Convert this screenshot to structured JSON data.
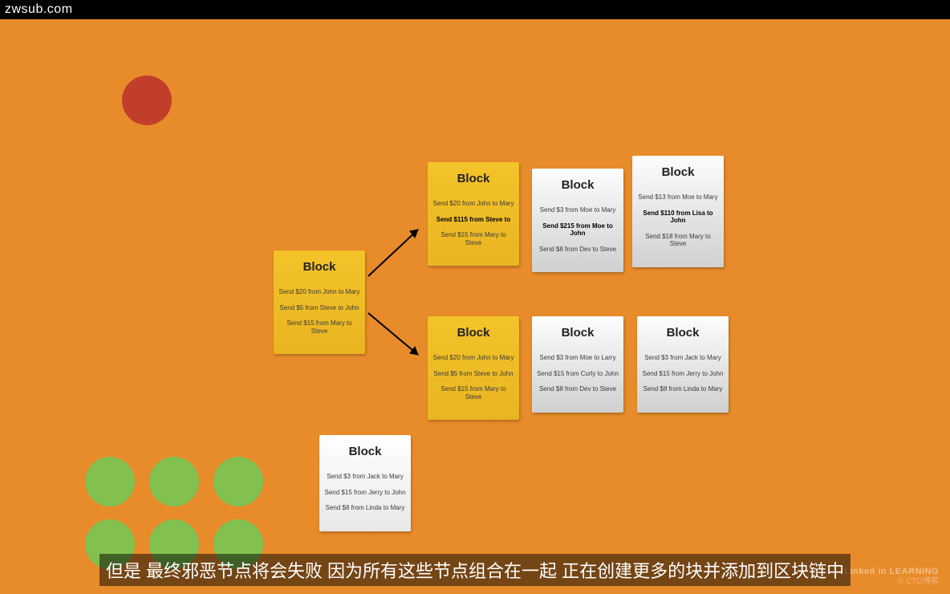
{
  "header": {
    "site": "zwsub.com"
  },
  "subtitle": "但是 最终邪恶节点将会失败 因为所有这些节点组合在一起 正在创建更多的块并添加到区块链中",
  "watermark": "Linked in LEARNING",
  "watermark2": "© CTO博客",
  "blocks": {
    "root": {
      "title": "Block",
      "tx": [
        "Send $20 from John to Mary",
        "Send $5 from Steve to John",
        "Send $15 from Mary to Steve"
      ]
    },
    "topYellow": {
      "title": "Block",
      "tx": [
        "Send $20 from John to Mary",
        "Send $115 from Steve to",
        "Send $15 from Mary to Steve"
      ],
      "bold": [
        false,
        true,
        false
      ]
    },
    "topGray1": {
      "title": "Block",
      "tx": [
        "Send $3 from Moe to Mary",
        "Send $215 from Moe to John",
        "Send $8 from Dev to Steve"
      ],
      "bold": [
        false,
        true,
        false
      ]
    },
    "topGray2": {
      "title": "Block",
      "tx": [
        "Send $13 from Moe to Mary",
        "Send $110 from Lisa to John",
        "Send $18 from Mary to Steve"
      ],
      "bold": [
        false,
        true,
        false
      ]
    },
    "botYellow": {
      "title": "Block",
      "tx": [
        "Send $20 from John to Mary",
        "Send $5 from Steve to John",
        "Send $15 from Mary to Steve"
      ]
    },
    "botGray1": {
      "title": "Block",
      "tx": [
        "Send $3 from Moe to Larry",
        "Send $15 from Curly to John",
        "Send $8 from Dev to Steve"
      ]
    },
    "botGray2": {
      "title": "Block",
      "tx": [
        "Send $3 from Jack to Mary",
        "Send $15 from Jerry to John",
        "Send $8 from Linda to Mary"
      ]
    },
    "extraWhite": {
      "title": "Block",
      "tx": [
        "Send $3 from Jack to Mary",
        "Send $15 from Jerry to John",
        "Send $8 from Linda to Mary"
      ]
    }
  }
}
